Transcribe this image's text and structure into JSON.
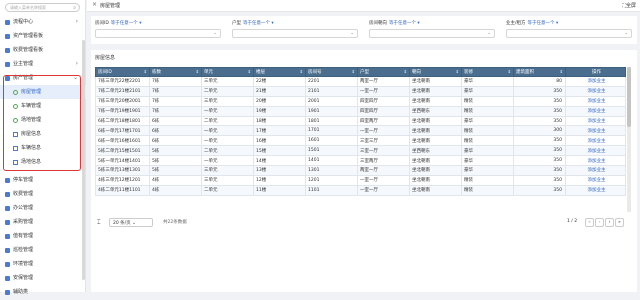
{
  "sidebar": {
    "search_placeholder": "请输入菜单名称搜索",
    "items": [
      {
        "label": "流程中心",
        "arrow": "›"
      },
      {
        "label": "资产管理看板",
        "arrow": ""
      },
      {
        "label": "收费管理看板",
        "arrow": ""
      },
      {
        "label": "业主管理",
        "arrow": "›"
      },
      {
        "label": "房产管理",
        "arrow": "⌄"
      }
    ],
    "sub_items": [
      {
        "label": "房屋管理",
        "active": true
      },
      {
        "label": "车辆管理",
        "active": false
      },
      {
        "label": "场地管理",
        "active": false
      },
      {
        "label": "房屋信息",
        "active": false
      },
      {
        "label": "车辆信息",
        "active": false
      },
      {
        "label": "场地信息",
        "active": false
      }
    ],
    "bottom_items": [
      {
        "label": "停车管理"
      },
      {
        "label": "收费管理"
      },
      {
        "label": "办公管理"
      },
      {
        "label": "采购管理"
      },
      {
        "label": "值有管理"
      },
      {
        "label": "巡检管理"
      },
      {
        "label": "环境管理"
      },
      {
        "label": "安保管理"
      },
      {
        "label": "辅助类"
      }
    ]
  },
  "topbar": {
    "tab": "房屋管理",
    "fullscreen": "全屏"
  },
  "filters": [
    {
      "label": "房间ID",
      "selector": "等于任意一个 ▾"
    },
    {
      "label": "户型",
      "selector": "等于任意一个 ▾"
    },
    {
      "label": "房间朝向",
      "selector": "等于任意一个 ▾"
    },
    {
      "label": "业主/租方",
      "selector": "等于任意一个 ▾"
    }
  ],
  "table": {
    "title": "房屋信息",
    "columns": [
      "房间ID",
      "栋数",
      "单元",
      "楼层",
      "房间号",
      "户型",
      "朝向",
      "装修",
      "建筑面积",
      "操作"
    ],
    "rows": [
      [
        "7栋三单元22楼2201",
        "7栋",
        "三单元",
        "22楼",
        "2201",
        "两室一厅",
        "坐北朝南",
        "豪华",
        "80",
        "添加业主"
      ],
      [
        "7栋二单元21楼2101",
        "7栋",
        "二单元",
        "21楼",
        "2101",
        "一室一厅",
        "坐北朝南",
        "豪华",
        "350",
        "添加业主"
      ],
      [
        "7栋三单元20楼2001",
        "7栋",
        "三单元",
        "20楼",
        "2001",
        "四室四厅",
        "坐北朝南",
        "精装",
        "350",
        "添加业主"
      ],
      [
        "7栋一单元19楼1901",
        "7栋",
        "一单元",
        "19楼",
        "1901",
        "四室四厅",
        "坐西朝东",
        "精装",
        "350",
        "添加业主"
      ],
      [
        "6栋二单元18楼1801",
        "6栋",
        "二单元",
        "18楼",
        "1801",
        "四室两厅",
        "坐北朝南",
        "豪华",
        "350",
        "添加业主"
      ],
      [
        "6栋一单元17楼1701",
        "6栋",
        "一单元",
        "17楼",
        "1701",
        "一室一厅",
        "坐北朝南",
        "精装",
        "300",
        "添加业主"
      ],
      [
        "6栋一单元16楼1601",
        "6栋",
        "一单元",
        "16楼",
        "1601",
        "三室三厅",
        "坐北朝南",
        "精装",
        "350",
        "添加业主"
      ],
      [
        "5栋二单元15楼1501",
        "5栋",
        "二单元",
        "15楼",
        "1501",
        "三室一厅",
        "坐西朝东",
        "豪华",
        "350",
        "添加业主"
      ],
      [
        "5栋一单元14楼1401",
        "5栋",
        "一单元",
        "14楼",
        "1401",
        "三室两厅",
        "坐北朝南",
        "豪华",
        "350",
        "添加业主"
      ],
      [
        "5栋三单元13楼1301",
        "5栋",
        "三单元",
        "13楼",
        "1301",
        "两室一厅",
        "坐北朝南",
        "豪华",
        "350",
        "添加业主"
      ],
      [
        "4栋三单元12楼1201",
        "4栋",
        "三单元",
        "12楼",
        "1201",
        "一室一厅",
        "坐北朝南",
        "精装",
        "350",
        "添加业主"
      ],
      [
        "4栋二单元11楼1101",
        "4栋",
        "二单元",
        "11楼",
        "1101",
        "一室一厅",
        "坐北朝南",
        "精装",
        "350",
        "添加业主"
      ]
    ]
  },
  "footer": {
    "page_size": "20 条/页",
    "total": "共22条数据",
    "page_info": "1  / 2"
  }
}
